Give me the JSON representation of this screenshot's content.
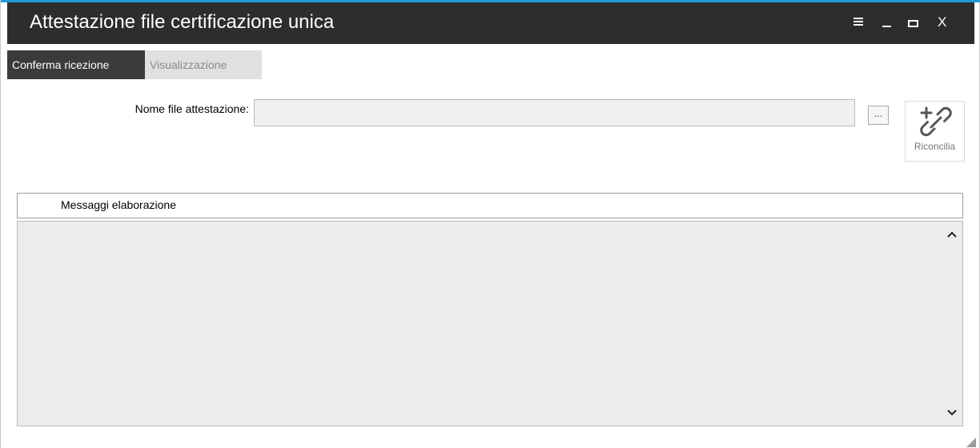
{
  "window": {
    "title": "Attestazione file certificazione unica",
    "accent_color": "#1e9bd7",
    "titlebar_color": "#2d2d2d",
    "controls": {
      "menu_icon": "hamburger-icon",
      "minimize_icon": "minimize-icon",
      "maximize_icon": "maximize-icon",
      "close_glyph": "X"
    }
  },
  "tabs": [
    {
      "label": "Conferma ricezione",
      "active": true
    },
    {
      "label": "Visualizzazione",
      "active": false
    }
  ],
  "form": {
    "file_label": "Nome file attestazione:",
    "file_value": "",
    "browse_label": "...",
    "reconcile_label": "Riconcilia",
    "reconcile_icon": "link-add-icon"
  },
  "messages": {
    "header": "Messaggi elaborazione",
    "content": "",
    "scroll_up_icon": "chevron-up-icon",
    "scroll_down_icon": "chevron-down-icon"
  }
}
